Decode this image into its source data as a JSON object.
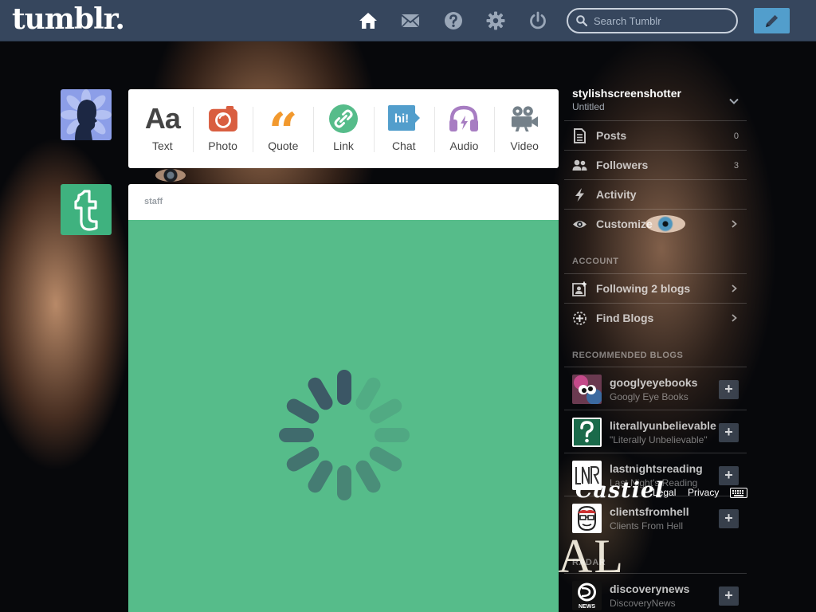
{
  "header": {
    "logo": "tumblr.",
    "nav_icons": [
      "home-icon",
      "envelope-icon",
      "help-icon",
      "gear-icon",
      "power-icon"
    ],
    "search": {
      "placeholder": "Search Tumblr",
      "value": ""
    },
    "compose_icon": "pencil-icon"
  },
  "post_types": [
    {
      "id": "text",
      "label": "Text",
      "glyph": "Aa",
      "color": "#444444"
    },
    {
      "id": "photo",
      "label": "Photo",
      "color": "#d95e40"
    },
    {
      "id": "quote",
      "label": "Quote",
      "glyph": "“",
      "color": "#f2992e"
    },
    {
      "id": "link",
      "label": "Link",
      "color": "#56bc8a"
    },
    {
      "id": "chat",
      "label": "Chat",
      "glyph": "hi!",
      "color": "#529ecc"
    },
    {
      "id": "audio",
      "label": "Audio",
      "color": "#a77dc2"
    },
    {
      "id": "video",
      "label": "Video",
      "color": "#748089"
    }
  ],
  "post": {
    "author": "staff",
    "media_color": "#56bc8a",
    "state": "loading"
  },
  "sidebar": {
    "blog": {
      "name": "stylishscreenshotter",
      "subtitle": "Untitled"
    },
    "stats": [
      {
        "label": "Posts",
        "count": "0",
        "icon": "posts-icon"
      },
      {
        "label": "Followers",
        "count": "3",
        "icon": "followers-icon"
      },
      {
        "label": "Activity",
        "icon": "lightning-icon"
      },
      {
        "label": "Customize",
        "icon": "eye-icon"
      }
    ],
    "account_heading": "ACCOUNT",
    "account_items": [
      {
        "label": "Following 2 blogs",
        "icon": "following-icon"
      },
      {
        "label": "Find Blogs",
        "icon": "find-blogs-icon"
      }
    ],
    "recommended_heading": "RECOMMENDED BLOGS",
    "recommended": [
      {
        "name": "googlyeyebooks",
        "title": "Googly Eye Books"
      },
      {
        "name": "literallyunbelievable",
        "title": "\"Literally Unbelievable\""
      },
      {
        "name": "lastnightsreading",
        "title": "Last Night's Reading"
      },
      {
        "name": "clientsfromhell",
        "title": "Clients From Hell"
      }
    ],
    "radar_heading": "RADAR",
    "radar": {
      "name": "discoverynews",
      "title": "DiscoveryNews"
    }
  },
  "footer": {
    "legal": "Legal",
    "privacy": "Privacy"
  },
  "backdrop": {
    "script_title": "Castiel",
    "letters": "AL"
  },
  "colors": {
    "header": "#36465d",
    "accent_blue": "#529ecc",
    "media_green": "#56bc8a",
    "spinner": "#3a5063"
  }
}
